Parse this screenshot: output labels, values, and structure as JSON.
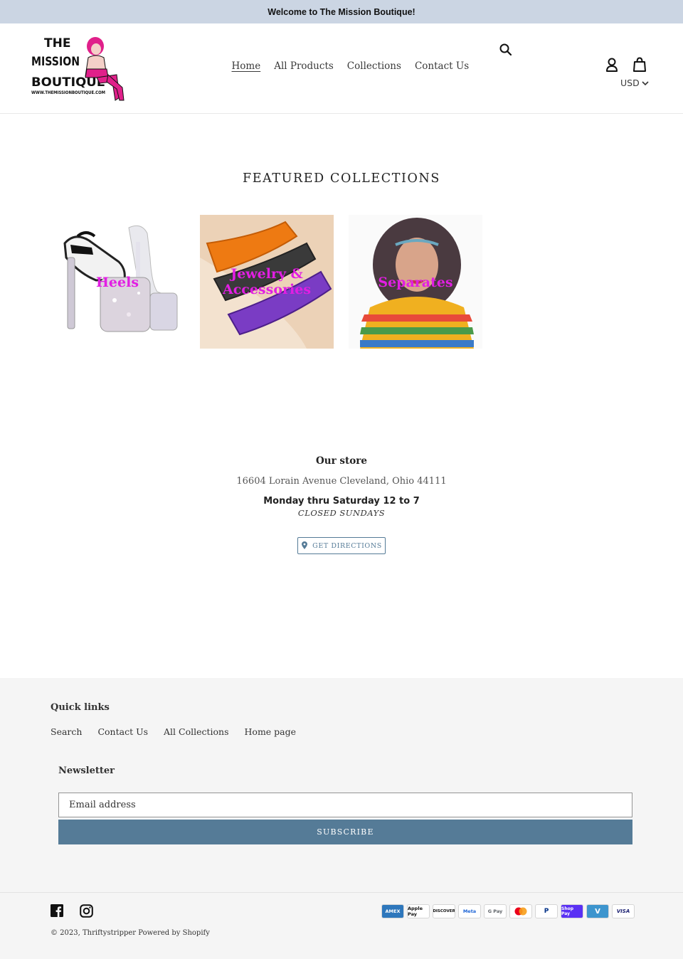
{
  "announcement": {
    "text": "Welcome to The Mission Boutique!"
  },
  "header": {
    "logo": {
      "line1": "THE",
      "line2": "MISSION",
      "line3": "BOUTIQUE",
      "line4": "WWW.THEMISSIONBOUTIQUE.COM"
    },
    "nav": [
      {
        "label": "Home",
        "active": true
      },
      {
        "label": "All Products"
      },
      {
        "label": "Collections"
      },
      {
        "label": "Contact Us"
      }
    ],
    "currency": "USD"
  },
  "featured": {
    "title": "FEATURED COLLECTIONS",
    "collections": [
      {
        "label": "Heels"
      },
      {
        "label": "Jewelry & Accessories"
      },
      {
        "label": "Separates"
      }
    ]
  },
  "store": {
    "title": "Our store",
    "address": "16604 Lorain Avenue Cleveland, Ohio  44111",
    "hours": "Monday thru Saturday 12 to 7",
    "closed": "CLOSED SUNDAYS",
    "directions_label": "GET DIRECTIONS"
  },
  "footer": {
    "quick_links_title": "Quick links",
    "quick_links": [
      "Search",
      "Contact Us",
      "All Collections",
      "Home page"
    ],
    "newsletter_title": "Newsletter",
    "email_placeholder": "Email address",
    "subscribe_label": "SUBSCRIBE",
    "payments": [
      "AMEX",
      "Apple Pay",
      "DISCOVER",
      "Meta",
      "G Pay",
      "",
      "P",
      "Shop Pay",
      "V",
      "VISA"
    ],
    "copyright_prefix": "© 2023,",
    "store_link": "Thriftystripper",
    "powered_by": "Powered by Shopify"
  },
  "colors": {
    "announcement_bg": "#cbd5e3",
    "accent": "#557b97",
    "collection_label": "#e21ee3",
    "footer_bg": "#f5f5f5"
  }
}
